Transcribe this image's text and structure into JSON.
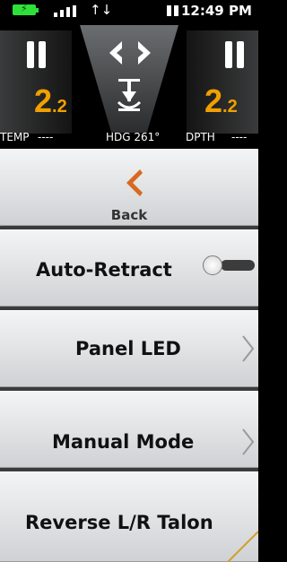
{
  "status_bar": {
    "battery_icon": "battery-charging-icon",
    "signal_icon": "signal-bars-icon",
    "sync_icon": "sync-arrows-icon",
    "sync_glyph": "↑↓",
    "pause_icon": "pause-icon",
    "time": "12:49 PM"
  },
  "header": {
    "left_pause_icon": "pause-icon",
    "right_pause_icon": "pause-icon",
    "left_arrow_icon": "chevron-left-icon",
    "right_arrow_icon": "chevron-right-icon",
    "anchor_icon": "anchor-down-icon",
    "left_depth_main": "2",
    "left_depth_sub": ".2",
    "right_depth_main": "2",
    "right_depth_sub": ".2",
    "temp_label": "TEMP",
    "temp_value": "----",
    "heading": "HDG 261°",
    "depth_label": "DPTH",
    "depth_value": "----",
    "accent_color": "#f0a000"
  },
  "menu": {
    "back_label": "Back",
    "back_icon": "chevron-left-icon",
    "back_color": "#d9691f",
    "items": [
      {
        "label": "Auto-Retract",
        "control": "toggle",
        "state": "off"
      },
      {
        "label": "Panel LED",
        "control": "chevron-right-icon"
      },
      {
        "label": "Manual Mode",
        "control": "chevron-right-icon"
      },
      {
        "label": "Reverse L/R Talon",
        "control": "none"
      }
    ]
  }
}
